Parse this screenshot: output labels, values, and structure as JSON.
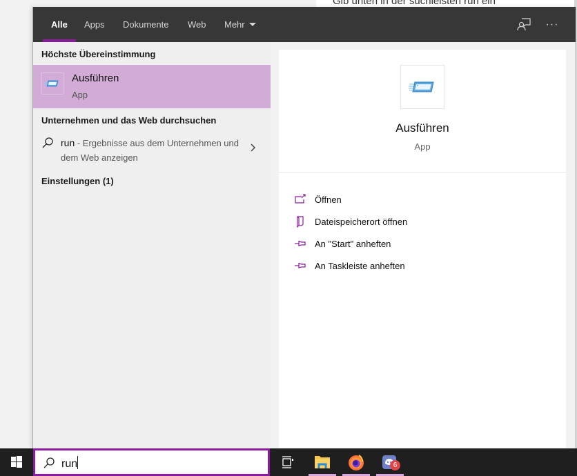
{
  "background_window": {
    "text": "Gib unten in der suchleisten run ein"
  },
  "flyout": {
    "tabs": [
      {
        "label": "Alle",
        "active": true
      },
      {
        "label": "Apps",
        "active": false
      },
      {
        "label": "Dokumente",
        "active": false
      },
      {
        "label": "Web",
        "active": false
      },
      {
        "label": "Mehr",
        "active": false,
        "has_dropdown": true
      }
    ],
    "top_icons": [
      {
        "name": "feedback-icon",
        "title": "Feedback"
      },
      {
        "name": "more-options-icon",
        "glyph": "···"
      }
    ],
    "left": {
      "best_match_heading": "Höchste Übereinstimmung",
      "best_match": {
        "title": "Ausführen",
        "subtitle": "App",
        "icon": "run-app-icon"
      },
      "web_heading": "Unternehmen und das Web durchsuchen",
      "web_result": {
        "query": "run",
        "description": " - Ergebnisse aus dem Unternehmen und dem Web anzeigen"
      },
      "settings_heading": "Einstellungen (1)"
    },
    "right": {
      "app_title": "Ausführen",
      "app_subtitle": "App",
      "actions": [
        {
          "label": "Öffnen",
          "icon": "open-icon"
        },
        {
          "label": "Dateispeicherort öffnen",
          "icon": "file-location-icon"
        },
        {
          "label": "An \"Start\" anheften",
          "icon": "pin-icon"
        },
        {
          "label": "An Taskleiste anheften",
          "icon": "pin-icon"
        }
      ]
    }
  },
  "taskbar": {
    "search_value": "run",
    "items": [
      {
        "name": "task-view",
        "active": false
      },
      {
        "name": "file-explorer",
        "active": true
      },
      {
        "name": "firefox",
        "active": true
      },
      {
        "name": "discord",
        "active": true,
        "badge": "6"
      }
    ]
  },
  "colors": {
    "accent": "#8a1b9e",
    "selection": "#d2acd7",
    "topbar": "#373737",
    "taskbar": "#201f1f"
  }
}
